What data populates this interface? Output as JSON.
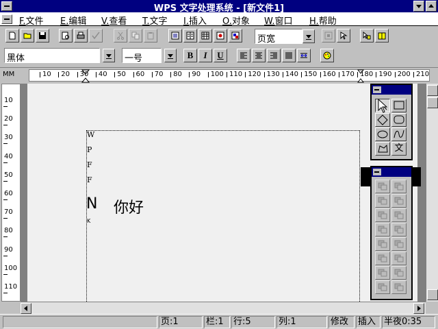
{
  "title": "WPS 文字处理系统 - [新文件1]",
  "menu": [
    {
      "key": "F.",
      "label": "文件"
    },
    {
      "key": "E.",
      "label": "编辑"
    },
    {
      "key": "V.",
      "label": "查看"
    },
    {
      "key": "T.",
      "label": "文字"
    },
    {
      "key": "I.",
      "label": "插入"
    },
    {
      "key": "O.",
      "label": "对象"
    },
    {
      "key": "W.",
      "label": "窗口"
    },
    {
      "key": "H.",
      "label": "帮助"
    }
  ],
  "toolbar": {
    "zoom_value": "页宽",
    "font_value": "黑体",
    "size_value": "一号",
    "bold_label": "B",
    "italic_label": "I",
    "underline_label": "U"
  },
  "ruler": {
    "unit": "MM",
    "h_labels": [
      "10",
      "20",
      "30",
      "40",
      "50",
      "60",
      "70",
      "80",
      "90",
      "100",
      "110",
      "120",
      "130",
      "140",
      "150",
      "160",
      "170",
      "180",
      "190",
      "200",
      "210"
    ],
    "v_labels": [
      "10",
      "20",
      "30",
      "40",
      "50",
      "60",
      "70",
      "80",
      "90",
      "100",
      "110"
    ]
  },
  "document": {
    "vertical_letters": [
      "W",
      "P",
      "F",
      "F"
    ],
    "line_char": "N",
    "line_text": "你好",
    "small_char": "K"
  },
  "draw_palette": {
    "text_tool_label": "文"
  },
  "status": {
    "page": "页:1",
    "column": "栏:1",
    "row": "行:5",
    "col": "列:1",
    "mode_edit": "修改",
    "mode_insert": "插入",
    "time": "半夜0:35"
  }
}
